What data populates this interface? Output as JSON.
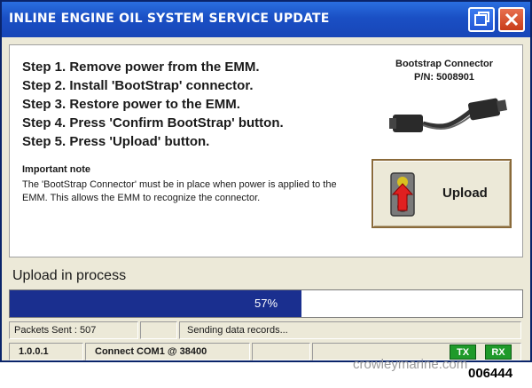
{
  "window": {
    "title": "INLINE ENGINE OIL SYSTEM SERVICE UPDATE",
    "restore_icon": "restore-window-icon",
    "close_icon": "close-icon"
  },
  "instructions": {
    "steps": [
      "Step 1. Remove power from the EMM.",
      "Step 2. Install 'BootStrap' connector.",
      "Step 3. Restore power to the EMM.",
      "Step 4. Press 'Confirm BootStrap' button.",
      "Step 5. Press 'Upload' button."
    ],
    "note_heading": "Important note",
    "note_text": "The 'BootStrap Connector' must be in place when power is applied to the EMM. This allows the EMM to recognize the connector."
  },
  "connector": {
    "label": "Bootstrap Connector",
    "part_number": "P/N: 5008901"
  },
  "upload_button": {
    "label": "Upload",
    "icon": "traffic-light-upload-icon"
  },
  "progress": {
    "status_label": "Upload in process",
    "percent": 57,
    "percent_text": "57%",
    "fill_color": "#1a2f8f"
  },
  "status_bar": {
    "packets_sent": "Packets Sent : 507",
    "message": "Sending data records...",
    "version": "1.0.0.1",
    "connection": "Connect COM1 @ 38400",
    "tx": "TX",
    "rx": "RX"
  },
  "footer": {
    "watermark": "crowleymarine.com",
    "figure_code": "006444"
  }
}
